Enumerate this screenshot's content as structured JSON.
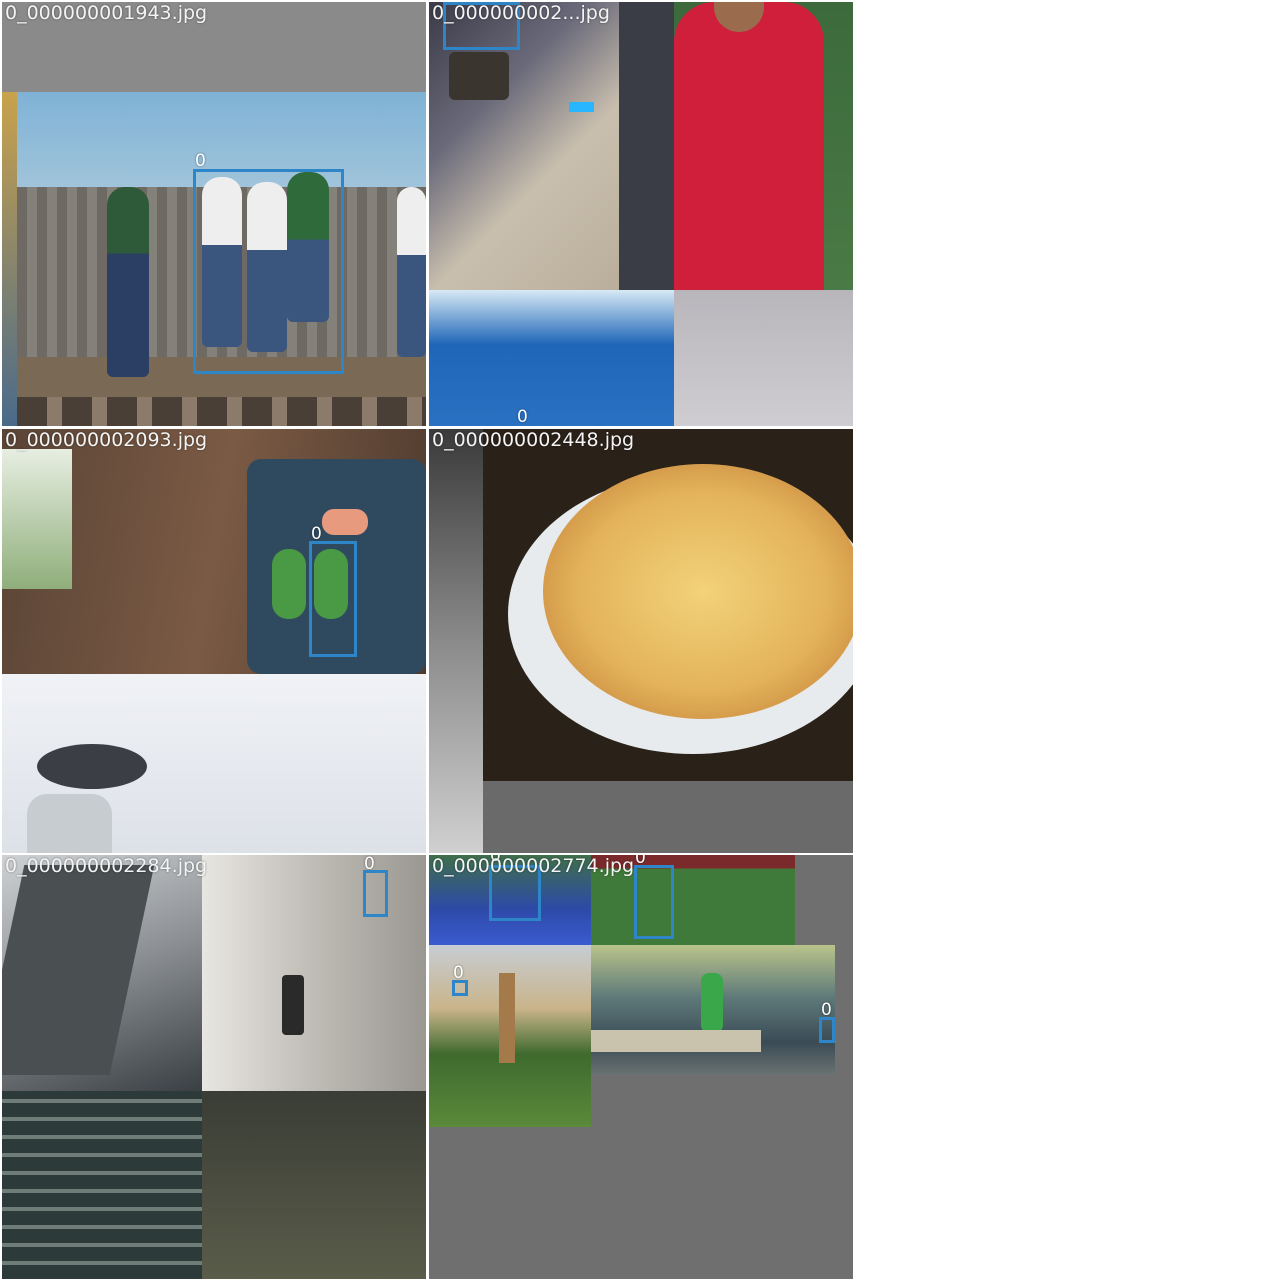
{
  "colors": {
    "box_stroke": "#2e86c8",
    "label_text": "#ffffff",
    "tile_background": "#6f6f6f",
    "page_background": "#ffffff"
  },
  "tiles": [
    {
      "filename": "0_000000001943.jpg",
      "boxes": [
        {
          "class_label": "0"
        }
      ]
    },
    {
      "filename": "0_000000002...jpg",
      "boxes": [
        {
          "class_label": "0"
        }
      ]
    },
    {
      "filename": "0_000000002093.jpg",
      "boxes": [
        {
          "class_label": "0"
        }
      ]
    },
    {
      "filename": "0_000000002448.jpg",
      "boxes": []
    },
    {
      "filename": "0_000000002284.jpg",
      "boxes": [
        {
          "class_label": "0"
        }
      ]
    },
    {
      "filename": "0_000000002774.jpg",
      "boxes": [
        {
          "class_label": "0"
        },
        {
          "class_label": "0"
        },
        {
          "class_label": "0"
        },
        {
          "class_label": "0"
        }
      ]
    }
  ]
}
